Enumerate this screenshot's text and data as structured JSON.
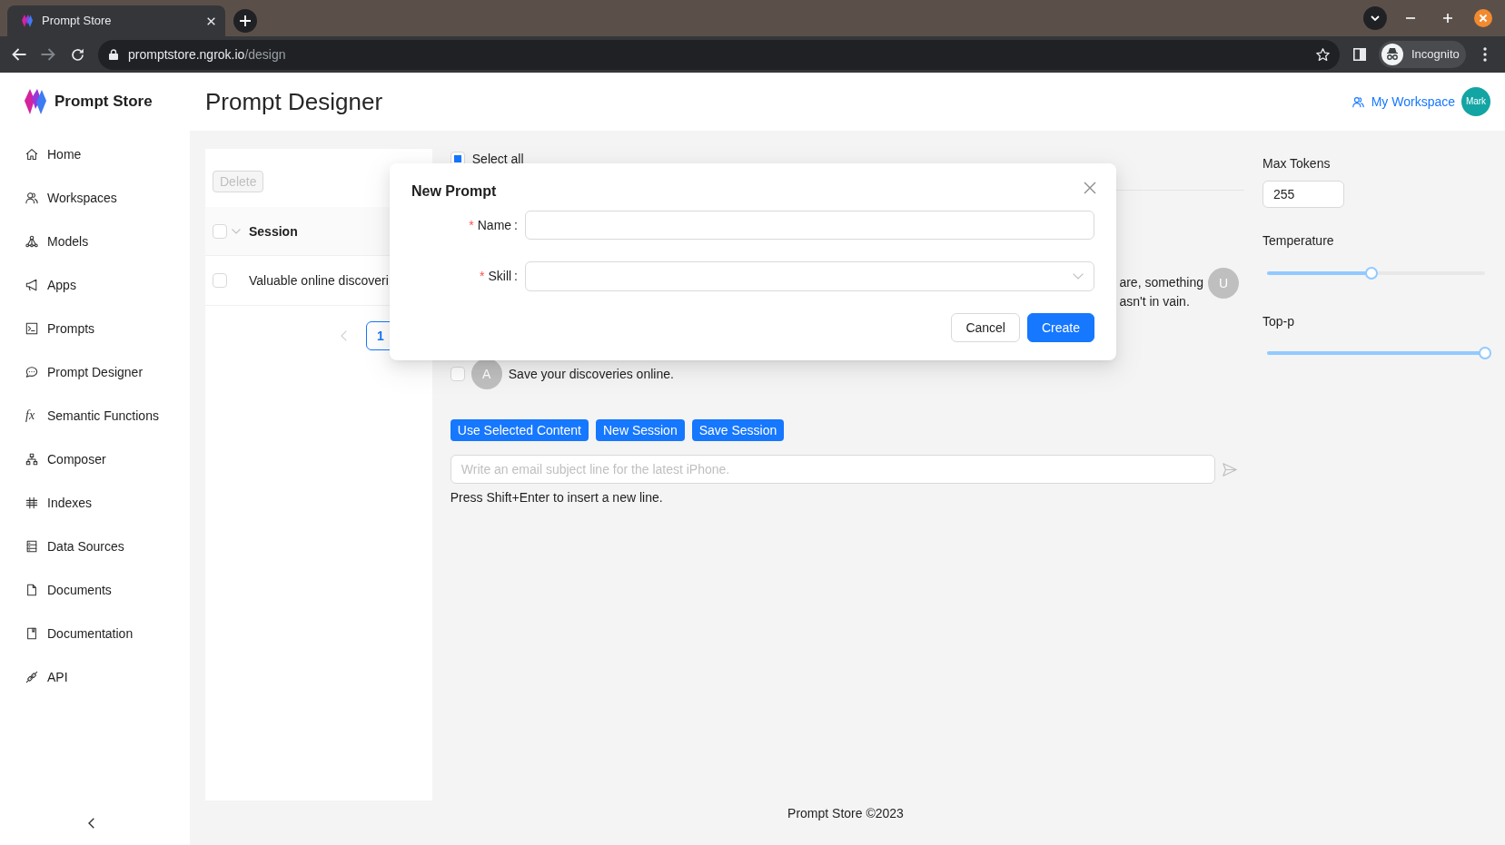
{
  "browser": {
    "tabs": [
      {
        "title": "Prompt Store",
        "selected": true
      }
    ],
    "address": {
      "host": "promptstore.ngrok.io",
      "path": "/design"
    },
    "profile": "Incognito"
  },
  "app": {
    "name": "Prompt Store"
  },
  "sidebar": {
    "items": [
      {
        "label": "Home",
        "selected": false
      },
      {
        "label": "Workspaces",
        "selected": false
      },
      {
        "label": "Models",
        "selected": false
      },
      {
        "label": "Apps",
        "selected": false
      },
      {
        "label": "Prompts",
        "selected": false
      },
      {
        "label": "Prompt Designer",
        "selected": false
      },
      {
        "label": "Semantic Functions",
        "glyph": "fx",
        "selected": false
      },
      {
        "label": "Composer",
        "selected": false
      },
      {
        "label": "Indexes",
        "selected": false
      },
      {
        "label": "Data Sources",
        "selected": false
      },
      {
        "label": "Documents",
        "selected": false
      },
      {
        "label": "Documentation",
        "selected": false
      },
      {
        "label": "API",
        "selected": false
      }
    ]
  },
  "header": {
    "title": "Prompt Designer",
    "workspace": "My Workspace",
    "avatar": "Mark"
  },
  "sessions": {
    "delete_button": {
      "label": "Delete",
      "disabled": true
    },
    "column": "Session",
    "header_checked": false,
    "rows": [
      {
        "title": "Valuable online discoveri",
        "checked": false
      }
    ],
    "pagination": {
      "prev_disabled": true,
      "pages": [
        {
          "label": "1",
          "selected": true
        }
      ]
    }
  },
  "chat": {
    "select_all": {
      "label": "Select all",
      "checked": false,
      "indeterminate": true
    },
    "messages": [
      {
        "kind": "user",
        "avatar": "U",
        "lines": [
          "are, something",
          "asn't in vain."
        ]
      },
      {
        "kind": "assistant",
        "avatar": "A",
        "checked": false,
        "lines": [
          "Save your discoveries online."
        ]
      }
    ],
    "actions": [
      "Use Selected Content",
      "New Session",
      "Save Session"
    ],
    "input": {
      "placeholder": "Write an email subject line for the latest iPhone."
    },
    "hint": "Press Shift+Enter to insert a new line."
  },
  "parameters": {
    "max_tokens": {
      "label": "Max Tokens",
      "value": "255"
    },
    "sliders": [
      {
        "label": "Temperature",
        "level": 0.48
      },
      {
        "label": "Top-p",
        "level": 1
      }
    ]
  },
  "modal": {
    "title": "New Prompt",
    "fields": [
      {
        "kind": "input",
        "required_mark": "*",
        "label": "Name",
        "colon": ":"
      },
      {
        "kind": "select",
        "required_mark": "*",
        "label": "Skill",
        "colon": ":"
      }
    ],
    "buttons": [
      {
        "label": "Cancel",
        "kind": "default"
      },
      {
        "label": "Create",
        "kind": "primary"
      }
    ]
  },
  "footer": "Prompt Store ©2023"
}
